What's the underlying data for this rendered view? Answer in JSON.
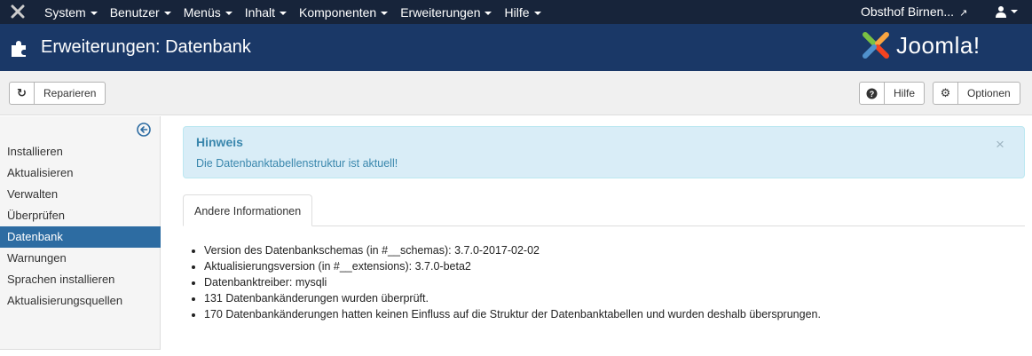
{
  "topbar": {
    "menus": [
      {
        "label": "System"
      },
      {
        "label": "Benutzer"
      },
      {
        "label": "Menüs"
      },
      {
        "label": "Inhalt"
      },
      {
        "label": "Komponenten"
      },
      {
        "label": "Erweiterungen"
      },
      {
        "label": "Hilfe"
      }
    ],
    "site_link": "Obsthof Birnen...",
    "site_link_icon": "external-link-icon",
    "user_icon": "user-icon"
  },
  "header": {
    "title": "Erweiterungen: Datenbank",
    "logo_text": "Joomla!",
    "icon": "puzzle-icon"
  },
  "toolbar": {
    "repair_label": "Reparieren",
    "repair_icon": "refresh-icon",
    "help_label": "Hilfe",
    "help_icon": "question-circle-icon",
    "options_label": "Optionen",
    "options_icon": "gear-icon"
  },
  "sidebar": {
    "items": [
      {
        "label": "Installieren"
      },
      {
        "label": "Aktualisieren"
      },
      {
        "label": "Verwalten"
      },
      {
        "label": "Überprüfen"
      },
      {
        "label": "Datenbank"
      },
      {
        "label": "Warnungen"
      },
      {
        "label": "Sprachen installieren"
      },
      {
        "label": "Aktualisierungsquellen"
      }
    ],
    "active_item": "Datenbank"
  },
  "alert": {
    "heading": "Hinweis",
    "message": "Die Datenbanktabellenstruktur ist aktuell!",
    "close": "×"
  },
  "tabs": [
    {
      "label": "Andere Informationen"
    }
  ],
  "info_items": [
    "Version des Datenbankschemas (in #__schemas): 3.7.0-2017-02-02",
    "Aktualisierungsversion (in #__extensions): 3.7.0-beta2",
    "Datenbanktreiber: mysqli",
    "131 Datenbankänderungen wurden überprüft.",
    "170 Datenbankänderungen hatten keinen Einfluss auf die Struktur der Datenbanktabellen und wurden deshalb übersprungen."
  ],
  "colors": {
    "topbar_bg": "#17243a",
    "header_bg": "#1a3867",
    "active_sidebar": "#2d6ca2",
    "alert_bg": "#d9edf7",
    "alert_text": "#3a87ad"
  }
}
